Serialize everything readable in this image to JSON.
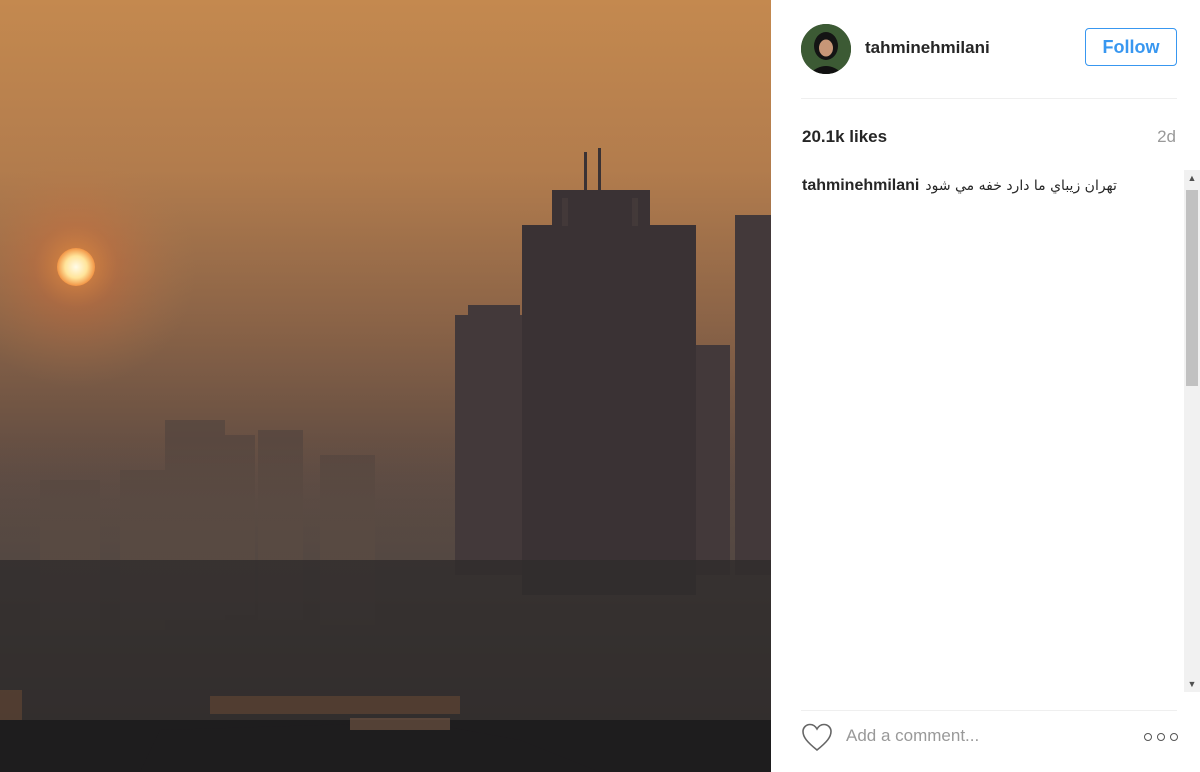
{
  "post": {
    "username": "tahminehmilani",
    "follow_label": "Follow",
    "likes": "20.1k likes",
    "time_ago": "2d",
    "caption_user": "tahminehmilani",
    "caption_text": "تهران زيباي ما دارد خفه مي شود",
    "comment_placeholder": "Add a comment..."
  },
  "icons": {
    "like": "heart-icon",
    "more": "more-options-icon",
    "avatar": "user-avatar"
  },
  "colors": {
    "follow": "#3897f0",
    "text": "#262626",
    "muted": "#999999"
  }
}
